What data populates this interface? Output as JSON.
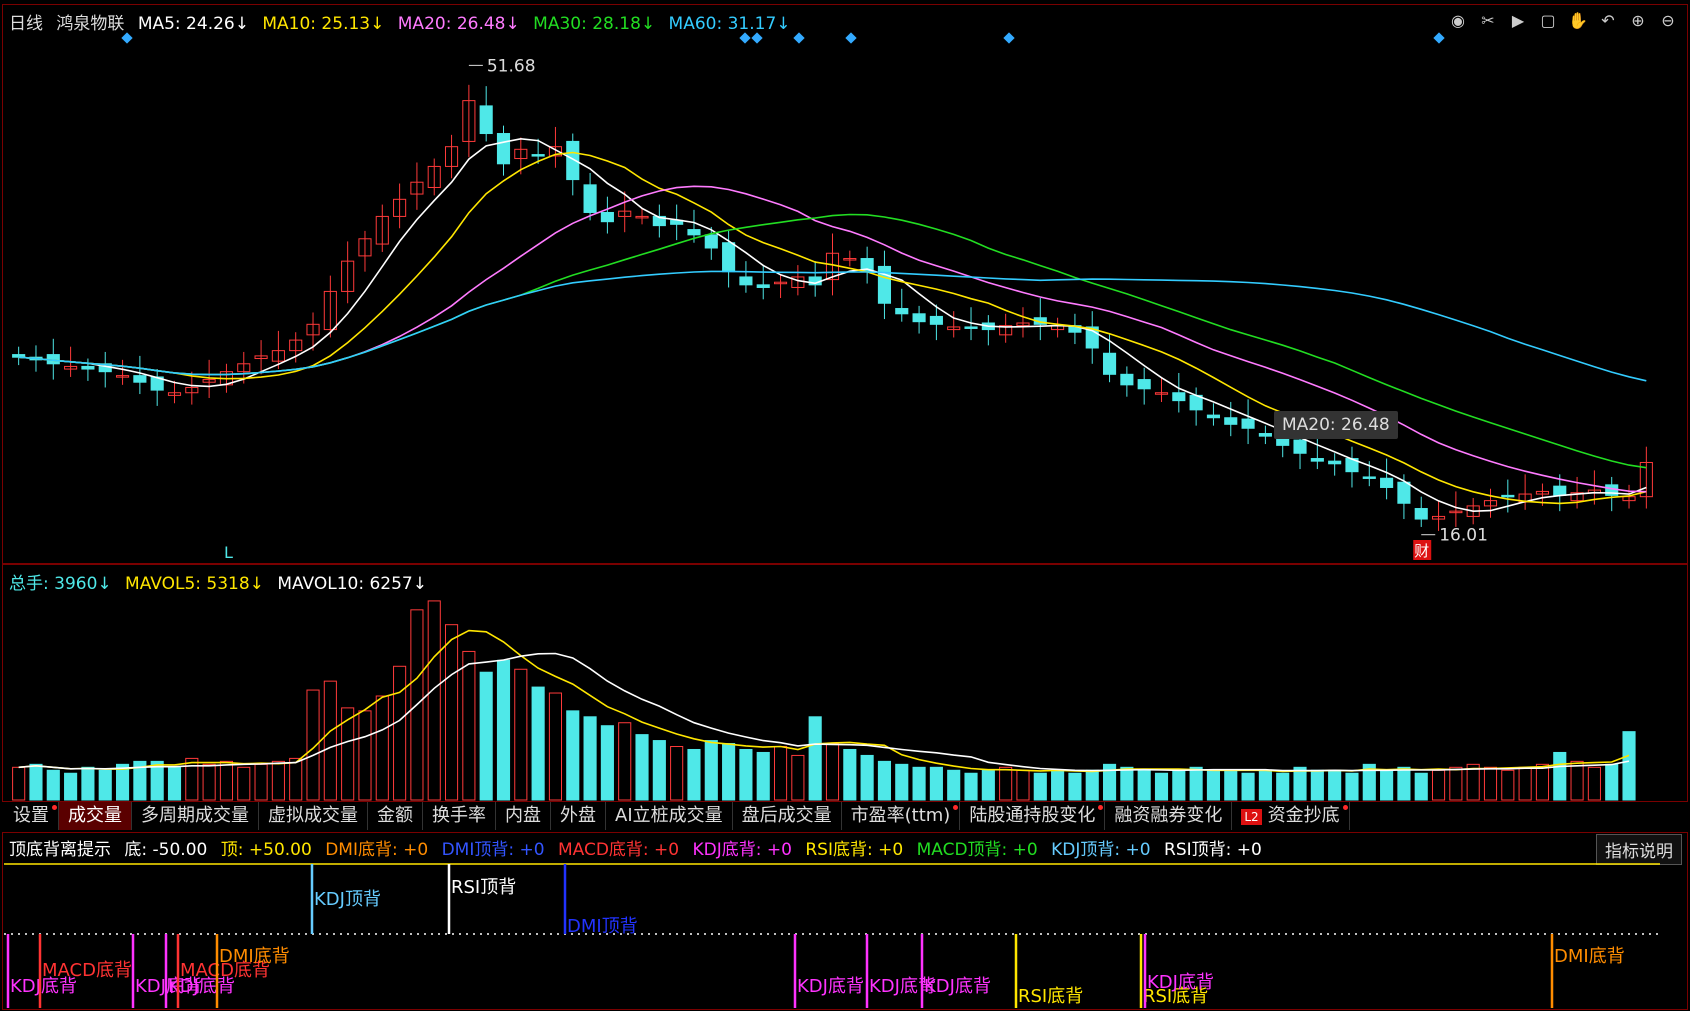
{
  "price_header": {
    "title": "日线",
    "stock_name": "鸿泉物联",
    "ma5": "MA5: 24.26↓",
    "ma10": "MA10: 25.13↓",
    "ma20": "MA20: 26.48↓",
    "ma30": "MA30: 28.18↓",
    "ma60": "MA60: 31.17↓"
  },
  "toolbar_icons": [
    "eye-icon",
    "scissors-icon",
    "play-icon",
    "lock-icon",
    "hand-icon",
    "undo-icon",
    "zoom-in-icon",
    "zoom-out-icon"
  ],
  "annotations": {
    "high": "51.68",
    "low": "16.01",
    "l_marker": "L",
    "cai_marker": "财",
    "tooltip": "MA20: 26.48"
  },
  "volume_header": {
    "total": "总手: 3960↓",
    "mavol5": "MAVOL5: 5318↓",
    "mavol10": "MAVOL10: 6257↓"
  },
  "tabs": [
    {
      "label": "设置",
      "dot": true
    },
    {
      "label": "成交量",
      "dot": false,
      "active": true
    },
    {
      "label": "多周期成交量",
      "dot": false
    },
    {
      "label": "虚拟成交量",
      "dot": false
    },
    {
      "label": "金额",
      "dot": false
    },
    {
      "label": "换手率",
      "dot": false
    },
    {
      "label": "内盘",
      "dot": false
    },
    {
      "label": "外盘",
      "dot": false
    },
    {
      "label": "AI立桩成交量",
      "dot": false
    },
    {
      "label": "盘后成交量",
      "dot": false
    },
    {
      "label": "市盈率(ttm)",
      "dot": true
    },
    {
      "label": "陆股通持股变化",
      "dot": true
    },
    {
      "label": "融资融券变化",
      "dot": false
    },
    {
      "label": "资金抄底",
      "dot": true,
      "l2": "L2"
    }
  ],
  "indicator_header": {
    "name": "顶底背离提示",
    "bottom": "底: -50.00",
    "top": "顶: +50.00",
    "dmi_bottom": "DMI底背: +0",
    "dmi_top": "DMI顶背: +0",
    "macd_bottom": "MACD底背: +0",
    "kdj_bottom": "KDJ底背: +0",
    "rsi_bottom": "RSI底背: +0",
    "macd_top": "MACD顶背: +0",
    "kdj_top": "KDJ顶背: +0",
    "rsi_top": "RSI顶背: +0"
  },
  "explain_button": "指标说明",
  "signals": {
    "kdj_top": "KDJ顶背",
    "rsi_top": "RSI顶背",
    "dmi_top": "DMI顶背",
    "kdj_bottom": "KDJ底背",
    "macd_bottom": "MACD底背",
    "dmi_bottom": "DMI底背",
    "rsi_bottom": "RSI底背"
  },
  "colors": {
    "up": "#ff3a3a",
    "down": "#4fe8e8",
    "ma5": "#ffffff",
    "ma10": "#ffe600",
    "ma20": "#ff7bff",
    "ma30": "#22dd22",
    "ma60": "#33ccff"
  },
  "chart_data": {
    "type": "candlestick",
    "series_close": [
      29.5,
      29.3,
      29.0,
      28.8,
      28.6,
      28.4,
      28.1,
      27.6,
      27.0,
      26.8,
      27.2,
      27.8,
      28.4,
      29.0,
      29.6,
      30.0,
      30.8,
      32.0,
      34.5,
      36.8,
      38.5,
      40.2,
      41.5,
      42.8,
      44.0,
      45.5,
      49.0,
      46.5,
      44.2,
      45.3,
      44.8,
      45.5,
      43.0,
      40.5,
      39.8,
      40.6,
      40.2,
      39.5,
      39.6,
      38.8,
      37.8,
      36.0,
      35.0,
      34.8,
      35.2,
      35.6,
      35.0,
      37.4,
      37.0,
      36.0,
      33.6,
      32.8,
      32.2,
      32.0,
      31.8,
      31.7,
      31.6,
      31.9,
      32.1,
      32.0,
      31.9,
      31.4,
      30.2,
      28.2,
      27.4,
      27.1,
      26.8,
      26.2,
      25.5,
      24.9,
      24.4,
      24.1,
      23.5,
      22.8,
      22.2,
      21.6,
      21.4,
      20.8,
      20.3,
      19.6,
      18.4,
      17.2,
      17.4,
      17.8,
      18.2,
      18.6,
      18.9,
      19.1,
      19.3,
      19.0,
      19.2,
      19.4,
      19.0,
      18.9,
      21.5
    ],
    "price_high": 51.68,
    "price_low": 16.01,
    "volume_values": [
      1100,
      1200,
      1000,
      900,
      1100,
      1000,
      1200,
      1300,
      1300,
      1100,
      1400,
      1200,
      1300,
      1100,
      1200,
      1300,
      1400,
      3700,
      4000,
      3100,
      3000,
      3500,
      4500,
      6400,
      6700,
      5900,
      5000,
      4300,
      4700,
      4400,
      3800,
      3600,
      3000,
      2800,
      2500,
      2600,
      2200,
      2000,
      1800,
      1700,
      2000,
      1900,
      1700,
      1600,
      1800,
      1500,
      2800,
      1900,
      1700,
      1500,
      1300,
      1200,
      1100,
      1100,
      1000,
      900,
      1000,
      1100,
      1000,
      900,
      1000,
      900,
      1000,
      1200,
      1100,
      1000,
      900,
      1000,
      1100,
      1000,
      1000,
      900,
      1000,
      900,
      1100,
      1000,
      1000,
      900,
      1200,
      1000,
      1100,
      900,
      1000,
      1100,
      1200,
      1100,
      1000,
      1100,
      1200,
      1600,
      1300,
      1100,
      1200,
      2300
    ],
    "legend": [
      "MA5",
      "MA10",
      "MA20",
      "MA30",
      "MA60"
    ]
  }
}
